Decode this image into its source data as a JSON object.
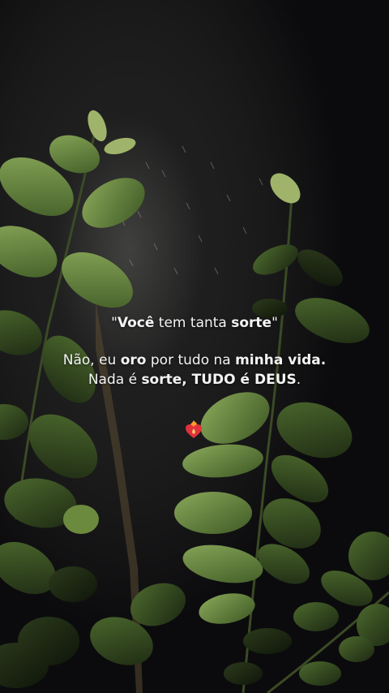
{
  "quote": {
    "line1": {
      "q_open": "\"",
      "w1": "Você",
      "w2": " tem tanta ",
      "w3": "sorte",
      "q_close": "\""
    },
    "line2": {
      "w1": "Não, eu ",
      "w2": "oro",
      "w3": " por tudo na ",
      "w4": "minha vida."
    },
    "line3": {
      "w1": "Nada é ",
      "w2": "sorte, TUDO é DEUS",
      "w3": "."
    }
  },
  "icons": {
    "heart": "heart-on-fire-icon"
  },
  "colors": {
    "background": "#0b0b0d",
    "leaf": "#5d7a3a",
    "leaf_dark": "#1f2b14",
    "text": "#f4f4f4",
    "heart": "#e0323c",
    "flame": "#ff9a2e"
  }
}
